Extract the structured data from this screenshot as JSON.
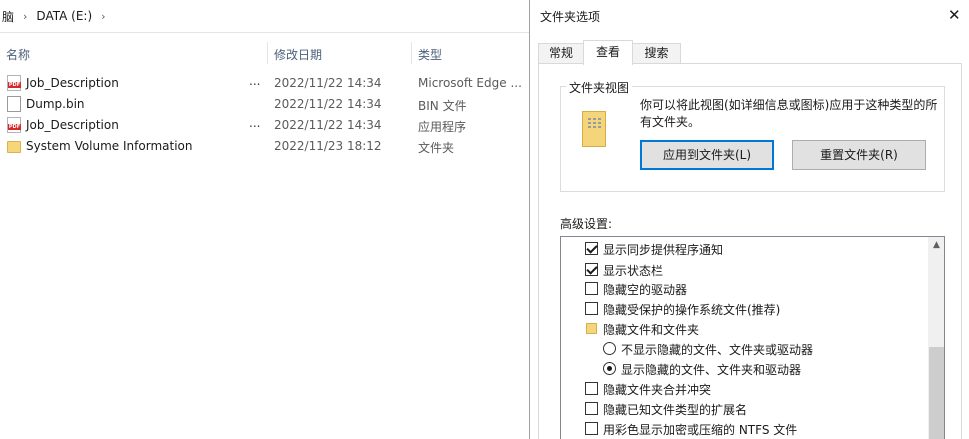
{
  "explorer": {
    "breadcrumb": [
      "脑",
      "DATA (E:)"
    ],
    "columns": {
      "name": "名称",
      "date": "修改日期",
      "type": "类型"
    },
    "files": [
      {
        "name": "Job_Description",
        "date": "2022/11/22 14:34",
        "type": "Microsoft Edge ...",
        "icon": "pdf-icon",
        "dots": "..."
      },
      {
        "name": "Dump.bin",
        "date": "2022/11/22 14:34",
        "type": "BIN 文件",
        "icon": "file-icon",
        "dots": ""
      },
      {
        "name": "Job_Description",
        "date": "2022/11/22 14:34",
        "type": "应用程序",
        "icon": "pdf-icon",
        "dots": "..."
      },
      {
        "name": "System Volume Information",
        "date": "2022/11/23 18:12",
        "type": "文件夹",
        "icon": "folder-icon",
        "dots": ""
      }
    ]
  },
  "dialog": {
    "title": "文件夹选项",
    "close": "✕",
    "tabs": [
      "常规",
      "查看",
      "搜索"
    ],
    "active_tab": "查看",
    "folder_views": {
      "legend": "文件夹视图",
      "description": "你可以将此视图(如详细信息或图标)应用于这种类型的所有文件夹。",
      "apply_button": "应用到文件夹(L)",
      "reset_button": "重置文件夹(R)"
    },
    "advanced_label": "高级设置:",
    "advanced_items": [
      {
        "kind": "checkbox",
        "checked": true,
        "label": "显示同步提供程序通知"
      },
      {
        "kind": "checkbox",
        "checked": true,
        "label": "显示状态栏"
      },
      {
        "kind": "checkbox",
        "checked": false,
        "label": "隐藏空的驱动器"
      },
      {
        "kind": "checkbox",
        "checked": false,
        "label": "隐藏受保护的操作系统文件(推荐)"
      },
      {
        "kind": "folder",
        "label": "隐藏文件和文件夹"
      },
      {
        "kind": "radio",
        "checked": false,
        "label": "不显示隐藏的文件、文件夹或驱动器"
      },
      {
        "kind": "radio",
        "checked": true,
        "label": "显示隐藏的文件、文件夹和驱动器"
      },
      {
        "kind": "checkbox",
        "checked": false,
        "label": "隐藏文件夹合并冲突"
      },
      {
        "kind": "checkbox",
        "checked": false,
        "label": "隐藏已知文件类型的扩展名"
      },
      {
        "kind": "checkbox",
        "checked": false,
        "label": "用彩色显示加密或压缩的 NTFS 文件"
      }
    ],
    "scroll_up": "▲"
  }
}
